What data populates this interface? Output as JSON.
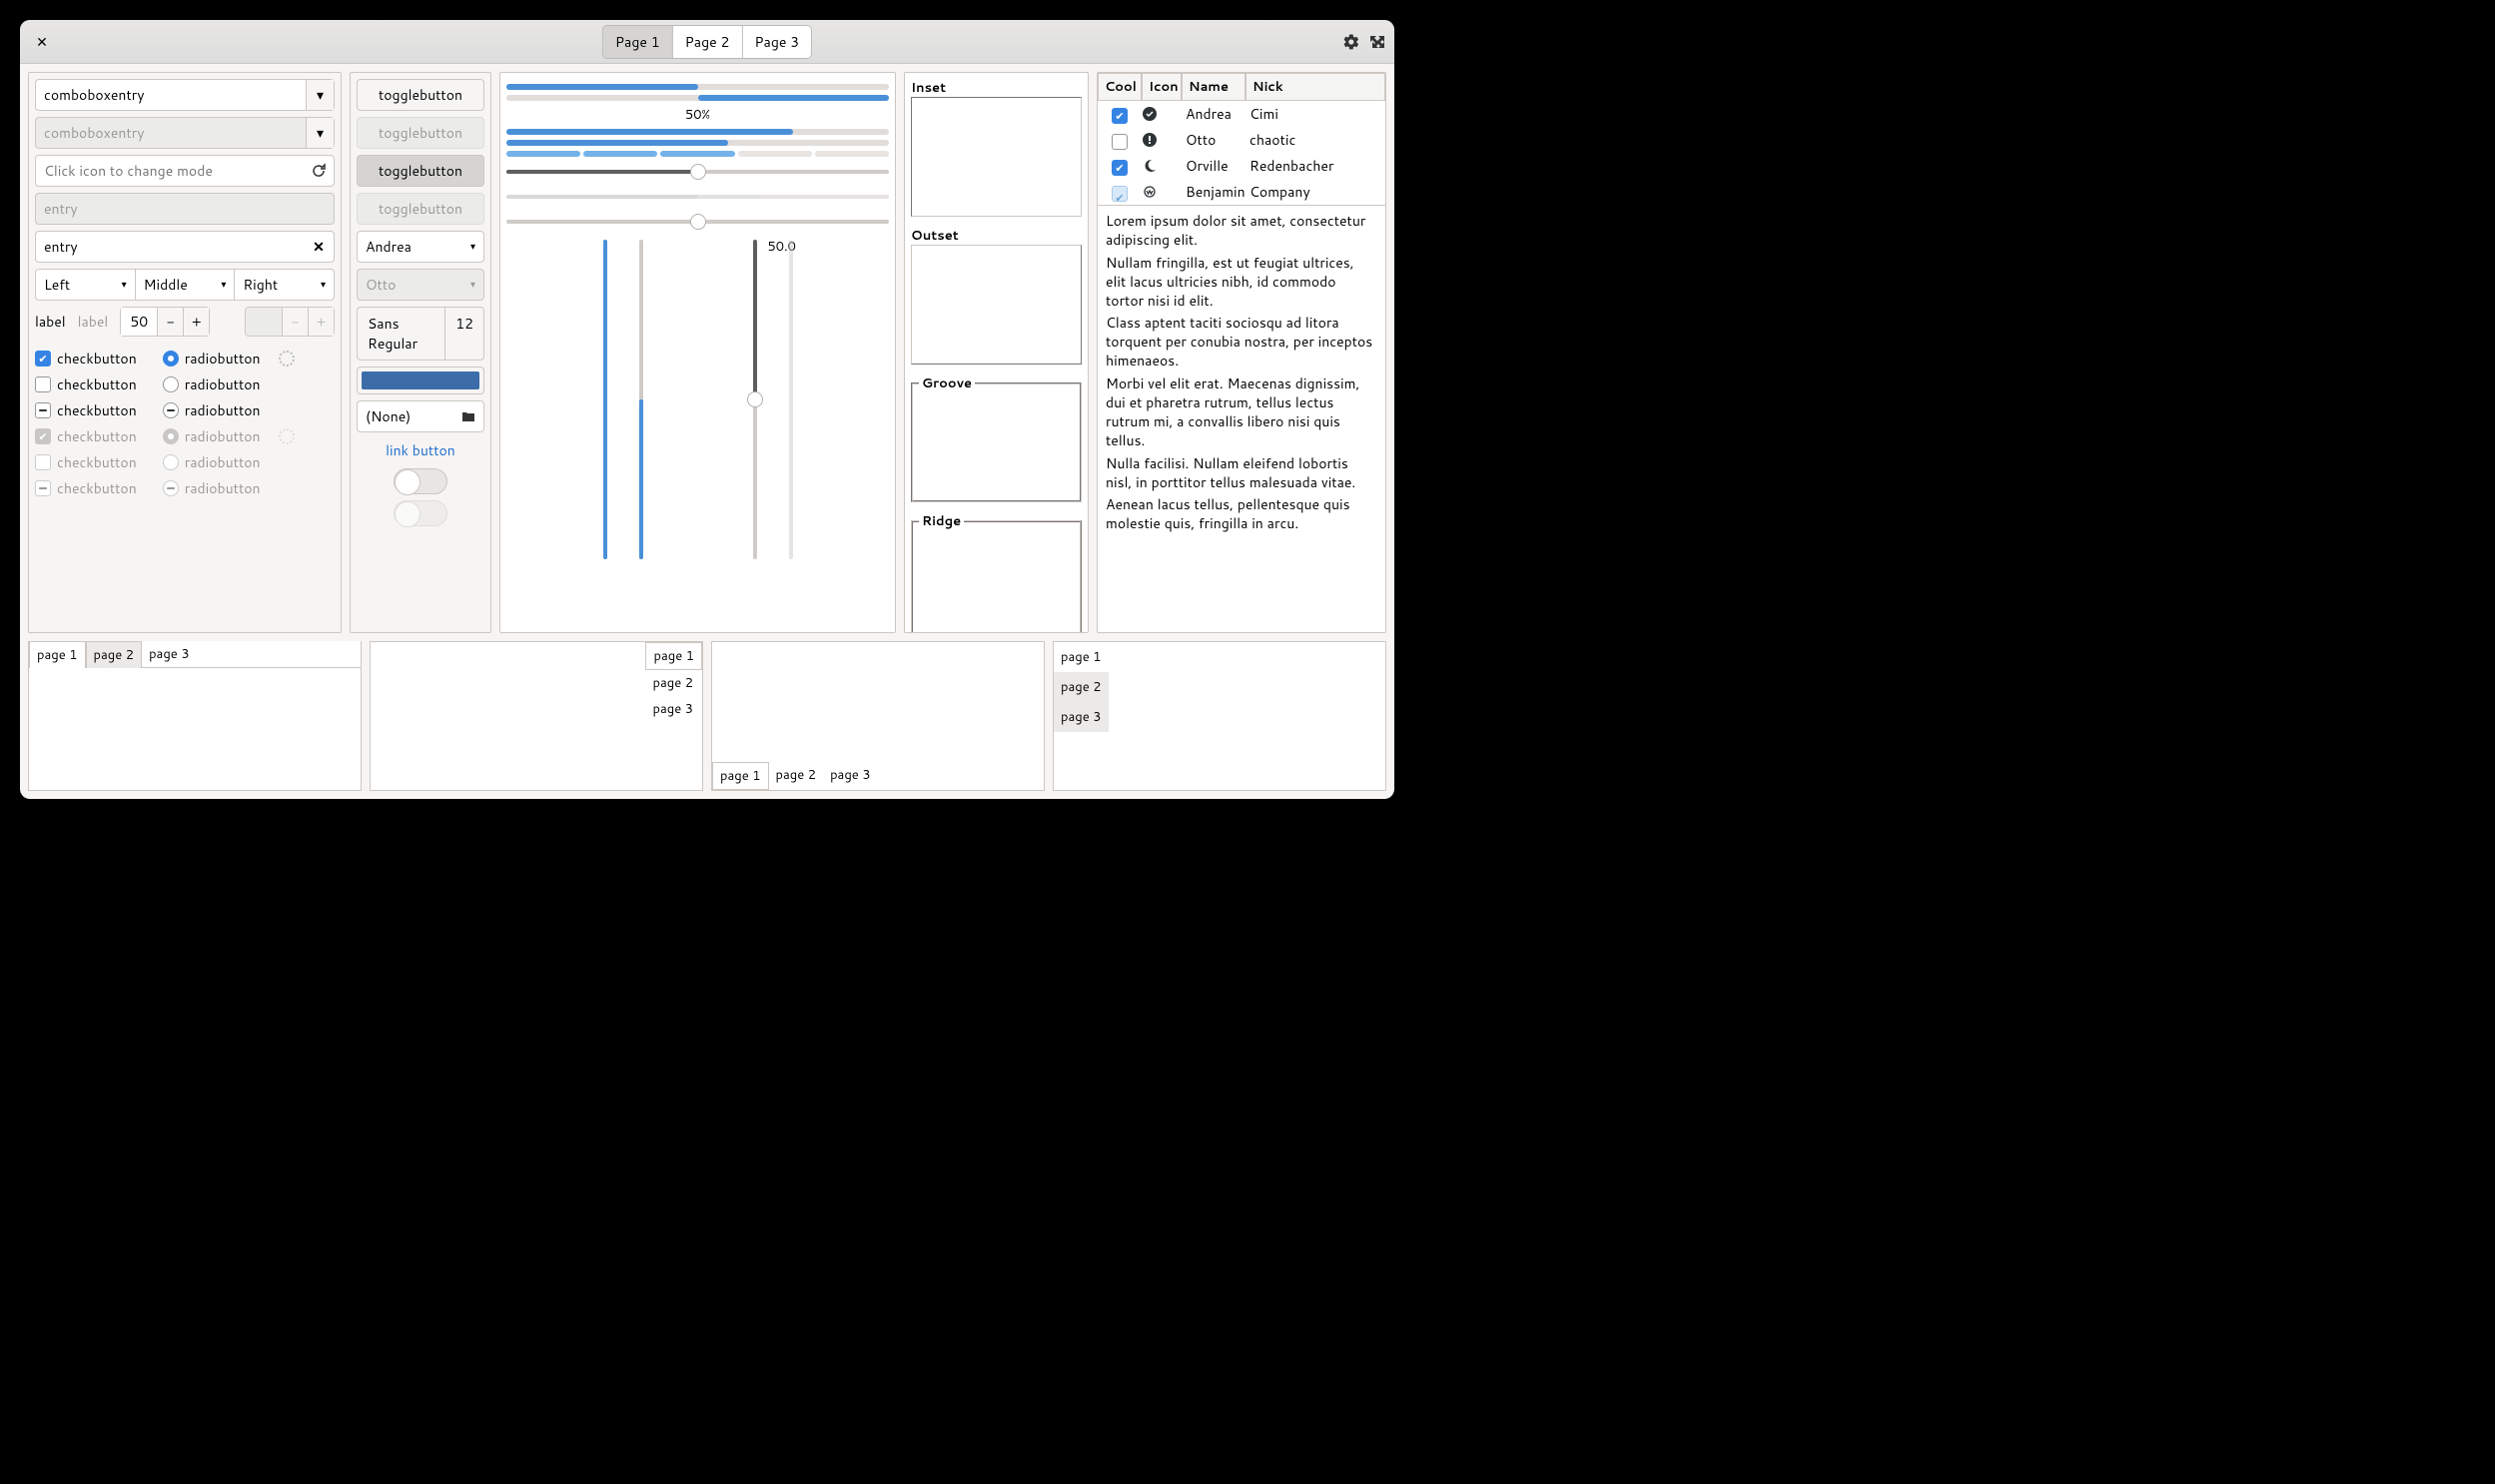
{
  "titlebar": {
    "tabs": [
      "Page 1",
      "Page 2",
      "Page 3"
    ],
    "active_tab": 0
  },
  "col1": {
    "combo1": "comboboxentry",
    "combo2": "comboboxentry",
    "mode_entry_placeholder": "Click icon to change mode",
    "entry_disabled": "entry",
    "entry_clear": "entry",
    "triple": [
      "Left",
      "Middle",
      "Right"
    ],
    "label1": "label",
    "label2": "label",
    "spin_value": "50",
    "check_label": "checkbutton",
    "radio_label": "radiobutton"
  },
  "col2": {
    "toggle_label": "togglebutton",
    "combo_andrea": "Andrea",
    "combo_otto": "Otto",
    "font_name": "Sans Regular",
    "font_size": "12",
    "color": "#3d6da9",
    "file_label": "(None)",
    "link_label": "link button"
  },
  "col3": {
    "pct_label": "50%",
    "vs_label": "50.0"
  },
  "col4": {
    "frames": [
      "Inset",
      "Outset",
      "Groove",
      "Ridge"
    ]
  },
  "treeview": {
    "headers": [
      "Cool",
      "Icon",
      "Name",
      "Nick"
    ],
    "rows": [
      {
        "cool": true,
        "icon": "check-circle",
        "name": "Andrea",
        "nick": "Cimi"
      },
      {
        "cool": false,
        "icon": "alert",
        "name": "Otto",
        "nick": "chaotic"
      },
      {
        "cool": true,
        "icon": "night",
        "name": "Orville",
        "nick": "Redenbacher"
      },
      {
        "cool": "dis",
        "icon": "crown",
        "name": "Benjamin",
        "nick": "Company"
      }
    ]
  },
  "lorem": [
    "Lorem ipsum dolor sit amet, consectetur adipiscing elit.",
    "Nullam fringilla, est ut feugiat ultrices, elit lacus ultricies nibh, id commodo tortor nisi id elit.",
    "Class aptent taciti sociosqu ad litora torquent per conubia nostra, per inceptos himenaeos.",
    "Morbi vel elit erat. Maecenas dignissim, dui et pharetra rutrum, tellus lectus rutrum mi, a convallis libero nisi quis tellus.",
    "Nulla facilisi. Nullam eleifend lobortis nisl, in porttitor tellus malesuada vitae.",
    "Aenean lacus tellus, pellentesque quis molestie quis, fringilla in arcu."
  ],
  "notebook_tabs": [
    "page 1",
    "page 2",
    "page 3"
  ]
}
